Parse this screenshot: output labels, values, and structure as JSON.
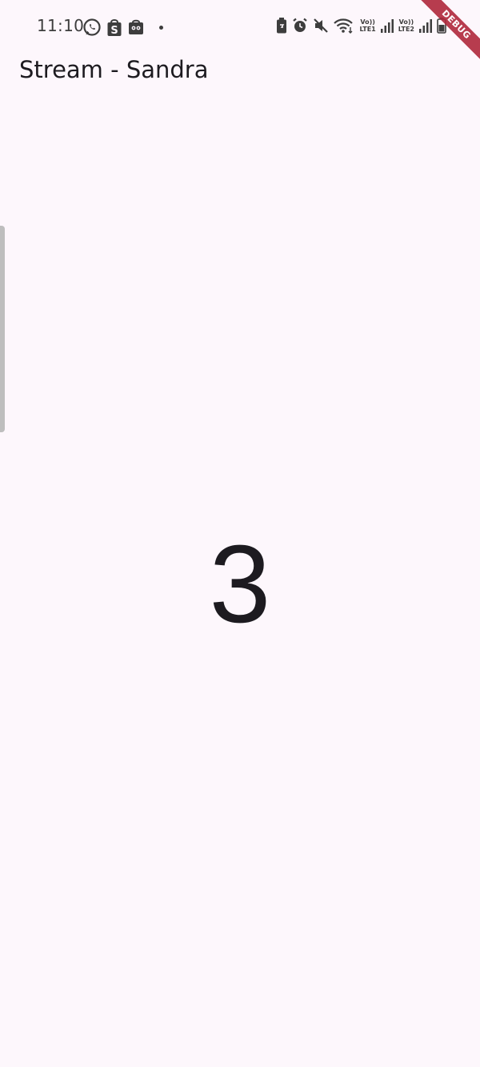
{
  "status_bar": {
    "time": "11:10",
    "notification_icons": [
      "whatsapp-icon",
      "shopee-icon",
      "bag-icon"
    ],
    "lte1_top": "Vo))",
    "lte1_bottom": "LTE1",
    "lte2_top": "Vo))",
    "lte2_bottom": "LTE2"
  },
  "debug_banner": {
    "label": "DEBUG",
    "color": "#B0283C"
  },
  "app_bar": {
    "title": "Stream - Sandra"
  },
  "main": {
    "counter": "3"
  },
  "colors": {
    "background": "#FDF7FC",
    "text": "#1D1B20"
  }
}
